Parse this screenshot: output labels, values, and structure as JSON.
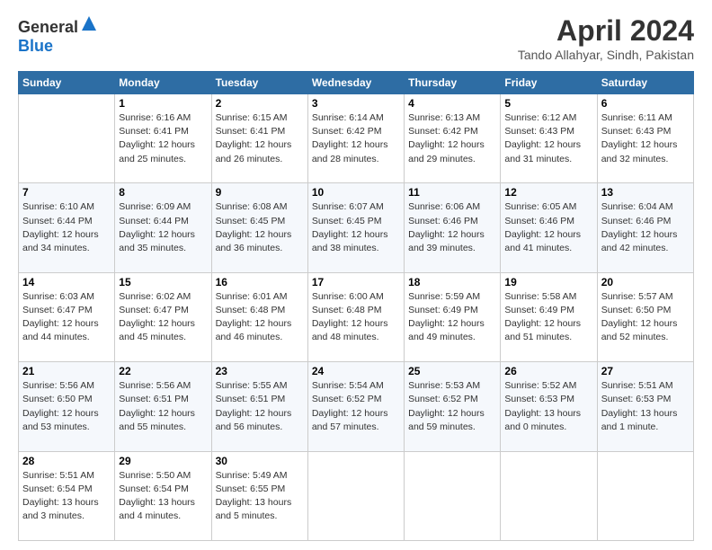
{
  "header": {
    "logo_general": "General",
    "logo_blue": "Blue",
    "title": "April 2024",
    "subtitle": "Tando Allahyar, Sindh, Pakistan"
  },
  "calendar": {
    "days_of_week": [
      "Sunday",
      "Monday",
      "Tuesday",
      "Wednesday",
      "Thursday",
      "Friday",
      "Saturday"
    ],
    "rows": [
      [
        {
          "day": "",
          "detail": ""
        },
        {
          "day": "1",
          "detail": "Sunrise: 6:16 AM\nSunset: 6:41 PM\nDaylight: 12 hours\nand 25 minutes."
        },
        {
          "day": "2",
          "detail": "Sunrise: 6:15 AM\nSunset: 6:41 PM\nDaylight: 12 hours\nand 26 minutes."
        },
        {
          "day": "3",
          "detail": "Sunrise: 6:14 AM\nSunset: 6:42 PM\nDaylight: 12 hours\nand 28 minutes."
        },
        {
          "day": "4",
          "detail": "Sunrise: 6:13 AM\nSunset: 6:42 PM\nDaylight: 12 hours\nand 29 minutes."
        },
        {
          "day": "5",
          "detail": "Sunrise: 6:12 AM\nSunset: 6:43 PM\nDaylight: 12 hours\nand 31 minutes."
        },
        {
          "day": "6",
          "detail": "Sunrise: 6:11 AM\nSunset: 6:43 PM\nDaylight: 12 hours\nand 32 minutes."
        }
      ],
      [
        {
          "day": "7",
          "detail": "Sunrise: 6:10 AM\nSunset: 6:44 PM\nDaylight: 12 hours\nand 34 minutes."
        },
        {
          "day": "8",
          "detail": "Sunrise: 6:09 AM\nSunset: 6:44 PM\nDaylight: 12 hours\nand 35 minutes."
        },
        {
          "day": "9",
          "detail": "Sunrise: 6:08 AM\nSunset: 6:45 PM\nDaylight: 12 hours\nand 36 minutes."
        },
        {
          "day": "10",
          "detail": "Sunrise: 6:07 AM\nSunset: 6:45 PM\nDaylight: 12 hours\nand 38 minutes."
        },
        {
          "day": "11",
          "detail": "Sunrise: 6:06 AM\nSunset: 6:46 PM\nDaylight: 12 hours\nand 39 minutes."
        },
        {
          "day": "12",
          "detail": "Sunrise: 6:05 AM\nSunset: 6:46 PM\nDaylight: 12 hours\nand 41 minutes."
        },
        {
          "day": "13",
          "detail": "Sunrise: 6:04 AM\nSunset: 6:46 PM\nDaylight: 12 hours\nand 42 minutes."
        }
      ],
      [
        {
          "day": "14",
          "detail": "Sunrise: 6:03 AM\nSunset: 6:47 PM\nDaylight: 12 hours\nand 44 minutes."
        },
        {
          "day": "15",
          "detail": "Sunrise: 6:02 AM\nSunset: 6:47 PM\nDaylight: 12 hours\nand 45 minutes."
        },
        {
          "day": "16",
          "detail": "Sunrise: 6:01 AM\nSunset: 6:48 PM\nDaylight: 12 hours\nand 46 minutes."
        },
        {
          "day": "17",
          "detail": "Sunrise: 6:00 AM\nSunset: 6:48 PM\nDaylight: 12 hours\nand 48 minutes."
        },
        {
          "day": "18",
          "detail": "Sunrise: 5:59 AM\nSunset: 6:49 PM\nDaylight: 12 hours\nand 49 minutes."
        },
        {
          "day": "19",
          "detail": "Sunrise: 5:58 AM\nSunset: 6:49 PM\nDaylight: 12 hours\nand 51 minutes."
        },
        {
          "day": "20",
          "detail": "Sunrise: 5:57 AM\nSunset: 6:50 PM\nDaylight: 12 hours\nand 52 minutes."
        }
      ],
      [
        {
          "day": "21",
          "detail": "Sunrise: 5:56 AM\nSunset: 6:50 PM\nDaylight: 12 hours\nand 53 minutes."
        },
        {
          "day": "22",
          "detail": "Sunrise: 5:56 AM\nSunset: 6:51 PM\nDaylight: 12 hours\nand 55 minutes."
        },
        {
          "day": "23",
          "detail": "Sunrise: 5:55 AM\nSunset: 6:51 PM\nDaylight: 12 hours\nand 56 minutes."
        },
        {
          "day": "24",
          "detail": "Sunrise: 5:54 AM\nSunset: 6:52 PM\nDaylight: 12 hours\nand 57 minutes."
        },
        {
          "day": "25",
          "detail": "Sunrise: 5:53 AM\nSunset: 6:52 PM\nDaylight: 12 hours\nand 59 minutes."
        },
        {
          "day": "26",
          "detail": "Sunrise: 5:52 AM\nSunset: 6:53 PM\nDaylight: 13 hours\nand 0 minutes."
        },
        {
          "day": "27",
          "detail": "Sunrise: 5:51 AM\nSunset: 6:53 PM\nDaylight: 13 hours\nand 1 minute."
        }
      ],
      [
        {
          "day": "28",
          "detail": "Sunrise: 5:51 AM\nSunset: 6:54 PM\nDaylight: 13 hours\nand 3 minutes."
        },
        {
          "day": "29",
          "detail": "Sunrise: 5:50 AM\nSunset: 6:54 PM\nDaylight: 13 hours\nand 4 minutes."
        },
        {
          "day": "30",
          "detail": "Sunrise: 5:49 AM\nSunset: 6:55 PM\nDaylight: 13 hours\nand 5 minutes."
        },
        {
          "day": "",
          "detail": ""
        },
        {
          "day": "",
          "detail": ""
        },
        {
          "day": "",
          "detail": ""
        },
        {
          "day": "",
          "detail": ""
        }
      ]
    ]
  }
}
